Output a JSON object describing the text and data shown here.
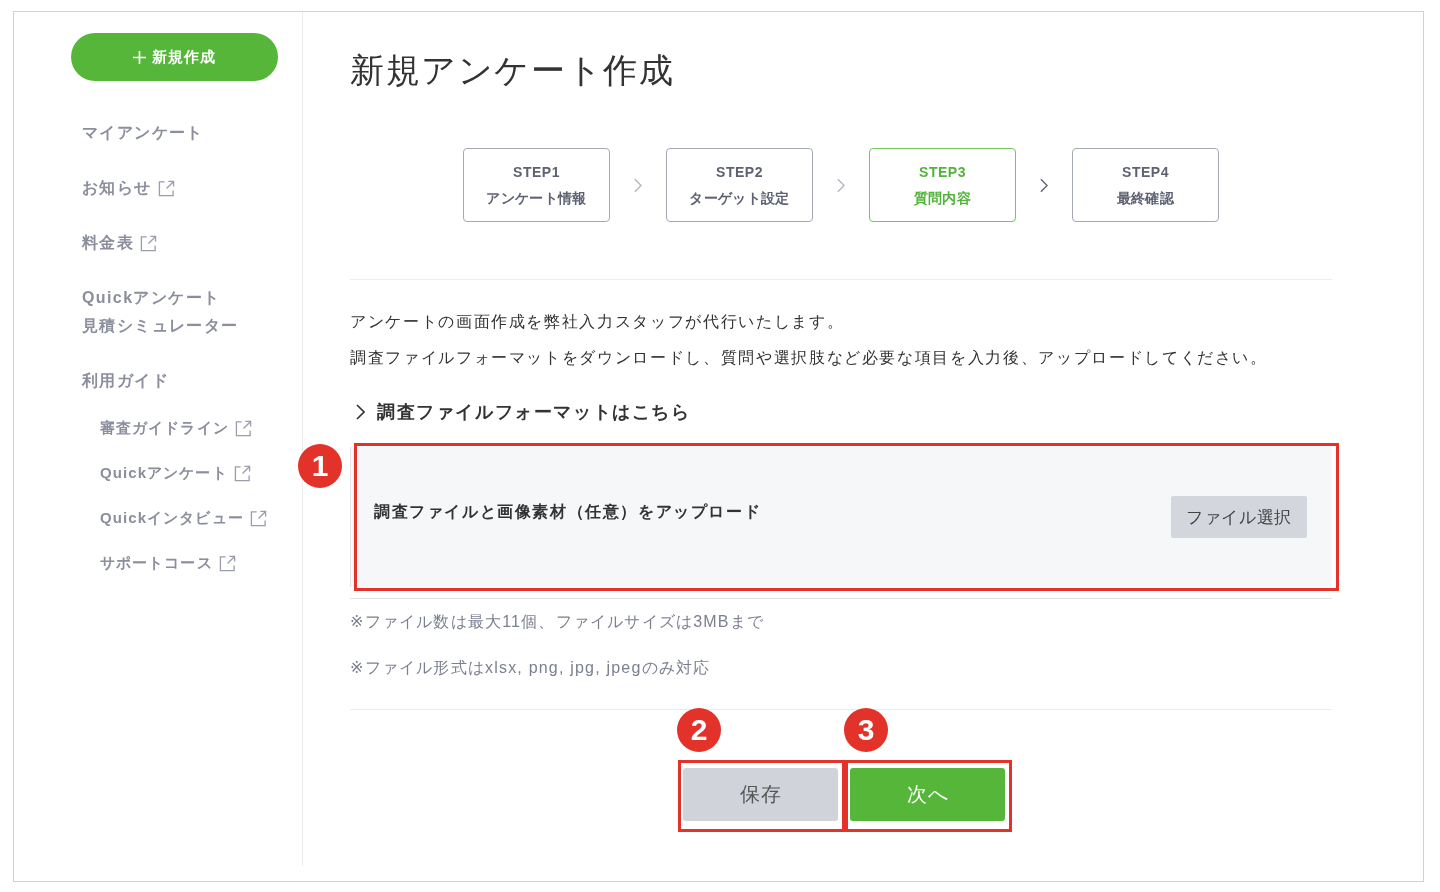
{
  "sidebar": {
    "new_button": {
      "label": "新規作成"
    },
    "items": [
      {
        "label": "マイアンケート",
        "external": false
      },
      {
        "label": "お知らせ",
        "external": true
      },
      {
        "label": "料金表",
        "external": true
      },
      {
        "lines": [
          "Quickアンケート",
          "見積シミュレーター"
        ],
        "external": false
      },
      {
        "label": "利用ガイド",
        "external": false,
        "children": [
          {
            "label": "審査ガイドライン",
            "external": true
          },
          {
            "label": "Quickアンケート",
            "external": true
          },
          {
            "label": "Quickインタビュー",
            "external": true
          },
          {
            "label": "サポートコース",
            "external": true
          }
        ]
      }
    ]
  },
  "main": {
    "title": "新規アンケート作成",
    "steps": [
      {
        "step": "STEP1",
        "label": "アンケート情報",
        "selected": false
      },
      {
        "step": "STEP2",
        "label": "ターゲット設定",
        "selected": false
      },
      {
        "step": "STEP3",
        "label": "質問内容",
        "selected": true
      },
      {
        "step": "STEP4",
        "label": "最終確認",
        "selected": false
      }
    ],
    "intro": [
      "アンケートの画面作成を弊社入力スタッフが代行いたします。",
      "調査ファイルフォーマットをダウンロードし、質問や選択肢など必要な項目を入力後、アップロードしてください。"
    ],
    "format_link": {
      "label": "調査ファイルフォーマットはこちら"
    },
    "upload": {
      "label": "調査ファイルと画像素材（任意）をアップロード",
      "button": "ファイル選択",
      "callout": "1"
    },
    "notes": [
      "※ファイル数は最大11個、ファイルサイズは3MBまで",
      "※ファイル形式はxlsx, png, jpg, jpegのみ対応"
    ],
    "actions": [
      {
        "label": "保存",
        "kind": "secondary",
        "callout": "2"
      },
      {
        "label": "次へ",
        "kind": "primary",
        "callout": "3"
      }
    ]
  }
}
